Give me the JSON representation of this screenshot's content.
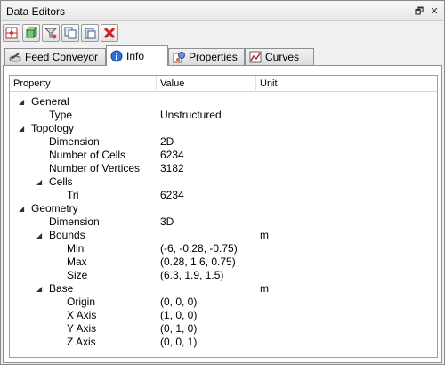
{
  "window": {
    "title": "Data Editors",
    "restore_glyph": "🗗",
    "close_glyph": "✕"
  },
  "toolbar": {
    "buttons": [
      {
        "name": "grid-node-icon"
      },
      {
        "name": "cube-icon"
      },
      {
        "name": "filter-icon"
      },
      {
        "name": "copy-icon"
      },
      {
        "name": "paste-icon"
      },
      {
        "name": "delete-icon"
      }
    ]
  },
  "tabs": [
    {
      "label": "Feed Conveyor",
      "icon": "conveyor-icon",
      "active": false
    },
    {
      "label": "Info",
      "icon": "info-icon",
      "active": true
    },
    {
      "label": "Properties",
      "icon": "properties-icon",
      "active": false
    },
    {
      "label": "Curves",
      "icon": "curves-icon",
      "active": false
    }
  ],
  "columns": {
    "property": "Property",
    "value": "Value",
    "unit": "Unit"
  },
  "rows": [
    {
      "label": "General",
      "value": "",
      "unit": "",
      "level": 0,
      "expanded": true
    },
    {
      "label": "Type",
      "value": "Unstructured",
      "unit": "",
      "level": 1
    },
    {
      "label": "Topology",
      "value": "",
      "unit": "",
      "level": 0,
      "expanded": true
    },
    {
      "label": "Dimension",
      "value": "2D",
      "unit": "",
      "level": 1
    },
    {
      "label": "Number of Cells",
      "value": "6234",
      "unit": "",
      "level": 1
    },
    {
      "label": "Number of Vertices",
      "value": "3182",
      "unit": "",
      "level": 1
    },
    {
      "label": "Cells",
      "value": "",
      "unit": "",
      "level": 1,
      "expanded": true
    },
    {
      "label": "Tri",
      "value": "6234",
      "unit": "",
      "level": 2
    },
    {
      "label": "Geometry",
      "value": "",
      "unit": "",
      "level": 0,
      "expanded": true
    },
    {
      "label": "Dimension",
      "value": "3D",
      "unit": "",
      "level": 1
    },
    {
      "label": "Bounds",
      "value": "",
      "unit": "m",
      "level": 1,
      "expanded": true
    },
    {
      "label": "Min",
      "value": "(-6, -0.28, -0.75)",
      "unit": "",
      "level": 2
    },
    {
      "label": "Max",
      "value": "(0.28, 1.6, 0.75)",
      "unit": "",
      "level": 2
    },
    {
      "label": "Size",
      "value": "(6.3, 1.9, 1.5)",
      "unit": "",
      "level": 2
    },
    {
      "label": "Base",
      "value": "",
      "unit": "m",
      "level": 1,
      "expanded": true
    },
    {
      "label": "Origin",
      "value": "(0, 0, 0)",
      "unit": "",
      "level": 2
    },
    {
      "label": "X Axis",
      "value": "(1, 0, 0)",
      "unit": "",
      "level": 2
    },
    {
      "label": "Y Axis",
      "value": "(0, 1, 0)",
      "unit": "",
      "level": 2
    },
    {
      "label": "Z Axis",
      "value": "(0, 0, 1)",
      "unit": "",
      "level": 2
    }
  ],
  "expand_glyph": "◢"
}
